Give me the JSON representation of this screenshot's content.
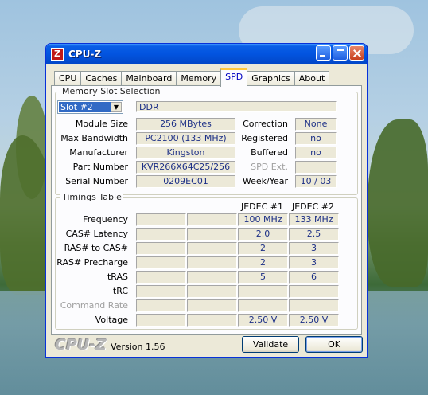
{
  "window": {
    "title": "CPU-Z",
    "icon_letter": "Z"
  },
  "tabs": [
    {
      "label": "CPU",
      "active": false
    },
    {
      "label": "Caches",
      "active": false
    },
    {
      "label": "Mainboard",
      "active": false
    },
    {
      "label": "Memory",
      "active": false
    },
    {
      "label": "SPD",
      "active": true
    },
    {
      "label": "Graphics",
      "active": false
    },
    {
      "label": "About",
      "active": false
    }
  ],
  "memory_slot": {
    "group_label": "Memory Slot Selection",
    "slot_value": "Slot #2",
    "type": "DDR",
    "module_size_label": "Module Size",
    "module_size": "256 MBytes",
    "max_bandwidth_label": "Max Bandwidth",
    "max_bandwidth": "PC2100 (133 MHz)",
    "manufacturer_label": "Manufacturer",
    "manufacturer": "Kingston",
    "part_number_label": "Part Number",
    "part_number": "KVR266X64C25/256",
    "serial_number_label": "Serial Number",
    "serial_number": "0209EC01",
    "correction_label": "Correction",
    "correction": "None",
    "registered_label": "Registered",
    "registered": "no",
    "buffered_label": "Buffered",
    "buffered": "no",
    "spd_ext_label": "SPD Ext.",
    "spd_ext": "",
    "week_year_label": "Week/Year",
    "week_year": "10 / 03"
  },
  "timings": {
    "group_label": "Timings Table",
    "col_headers": [
      "",
      "",
      "JEDEC #1",
      "JEDEC #2"
    ],
    "rows": [
      {
        "label": "Frequency",
        "values": [
          "",
          "",
          "100 MHz",
          "133 MHz"
        ],
        "dim": false
      },
      {
        "label": "CAS# Latency",
        "values": [
          "",
          "",
          "2.0",
          "2.5"
        ],
        "dim": false
      },
      {
        "label": "RAS# to CAS#",
        "values": [
          "",
          "",
          "2",
          "3"
        ],
        "dim": false
      },
      {
        "label": "RAS# Precharge",
        "values": [
          "",
          "",
          "2",
          "3"
        ],
        "dim": false
      },
      {
        "label": "tRAS",
        "values": [
          "",
          "",
          "5",
          "6"
        ],
        "dim": false
      },
      {
        "label": "tRC",
        "values": [
          "",
          "",
          "",
          ""
        ],
        "dim": false
      },
      {
        "label": "Command Rate",
        "values": [
          "",
          "",
          "",
          ""
        ],
        "dim": true
      },
      {
        "label": "Voltage",
        "values": [
          "",
          "",
          "2.50 V",
          "2.50 V"
        ],
        "dim": false
      }
    ]
  },
  "footer": {
    "brand": "CPU-Z",
    "version": "Version 1.56",
    "validate_label": "Validate",
    "ok_label": "OK"
  },
  "colors": {
    "title_bar": "#0254e0",
    "value_text": "#1c2f86",
    "active_tab_text": "#0000c0"
  }
}
